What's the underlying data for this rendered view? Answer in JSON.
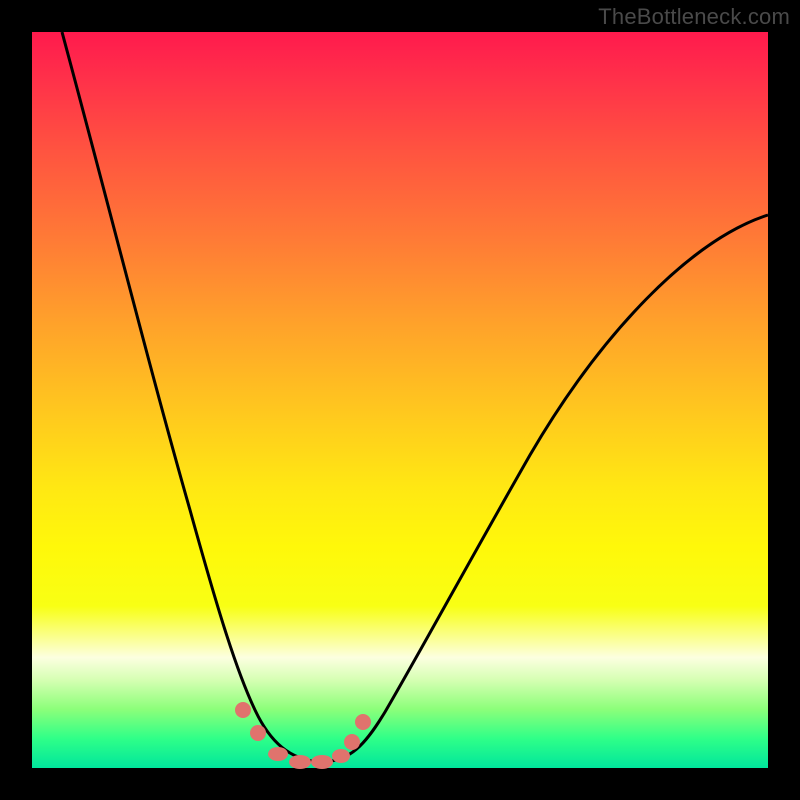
{
  "watermark": "TheBottleneck.com",
  "colors": {
    "gradient_top": "#ff1a4d",
    "gradient_mid": "#ffe813",
    "gradient_bottom": "#00e69c",
    "curve": "#000000",
    "marker": "#e0736d",
    "frame": "#000000"
  },
  "chart_data": {
    "type": "line",
    "title": "",
    "xlabel": "",
    "ylabel": "",
    "xlim": [
      0,
      100
    ],
    "ylim": [
      0,
      100
    ],
    "percent_y": true,
    "series": [
      {
        "name": "curve-left",
        "x": [
          4,
          8,
          12,
          16,
          19,
          22,
          24,
          26,
          28,
          30,
          32,
          34,
          37,
          40
        ],
        "y": [
          100,
          82,
          64,
          48,
          36,
          25,
          18,
          12,
          7,
          4,
          2,
          1,
          0,
          0
        ]
      },
      {
        "name": "curve-right",
        "x": [
          40,
          44,
          48,
          52,
          56,
          60,
          66,
          72,
          78,
          84,
          90,
          96,
          100
        ],
        "y": [
          0,
          2,
          6,
          11,
          17,
          23,
          32,
          41,
          49,
          57,
          64,
          71,
          75
        ]
      }
    ],
    "markers": {
      "name": "marker-dots",
      "x": [
        28.5,
        30.5,
        33.0,
        36.5,
        39.5,
        41.5,
        43.0,
        44.5
      ],
      "y": [
        7,
        4,
        1,
        0,
        0,
        2,
        4,
        7
      ]
    },
    "grid": false,
    "legend": false
  }
}
